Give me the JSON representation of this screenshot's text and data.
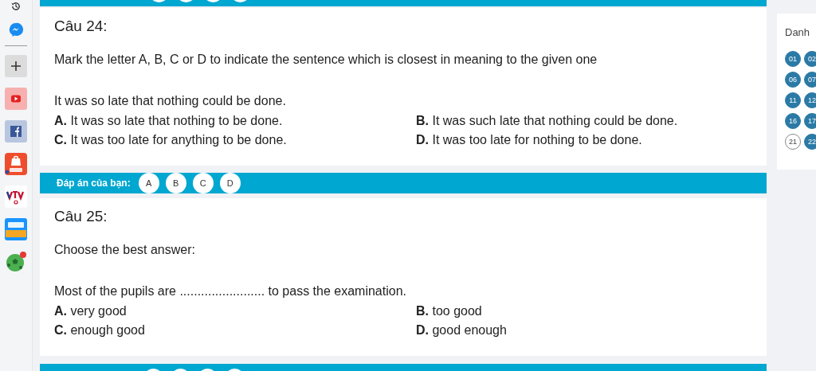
{
  "sidebar": {
    "items": [
      {
        "kind": "history"
      },
      {
        "kind": "messenger"
      },
      {
        "kind": "divider"
      },
      {
        "kind": "add"
      },
      {
        "kind": "youtube"
      },
      {
        "kind": "facebook"
      },
      {
        "kind": "shop"
      },
      {
        "kind": "tv"
      },
      {
        "kind": "sale"
      },
      {
        "kind": "ball"
      }
    ]
  },
  "questions": [
    {
      "title": "Câu 24:",
      "instruction": "Mark the letter A, B, C or D to indicate the sentence which is closest in meaning to the given one",
      "prompt": "It was so late that nothing could be done.",
      "options": [
        "**A.** It was so late that nothing to be done.",
        "**B.** It was such late that nothing could be done.",
        "**C.** It was too late for anything to be done.",
        "**D.** It was too late for nothing to be done."
      ],
      "answer_bar": {
        "label": "Đáp án của bạn:",
        "choices": [
          {
            "label": "A",
            "selected": false
          },
          {
            "label": "B",
            "selected": false
          },
          {
            "label": "C",
            "selected": false
          },
          {
            "label": "D",
            "selected": false
          }
        ]
      }
    },
    {
      "title": "Câu 25:",
      "instruction": "Choose the best answer:",
      "prompt": "Most of the pupils are ........................ to pass the examination.",
      "options": [
        "**A.** very good",
        "**B.** too good",
        "**C.** enough good",
        "**D.** good enough"
      ]
    }
  ],
  "question_list": {
    "title": "Danh",
    "items": [
      {
        "label": "01",
        "answered": true
      },
      {
        "label": "02",
        "answered": true
      },
      {
        "label": "06",
        "answered": true
      },
      {
        "label": "07",
        "answered": true
      },
      {
        "label": "11",
        "answered": true
      },
      {
        "label": "12",
        "answered": true
      },
      {
        "label": "16",
        "answered": true
      },
      {
        "label": "17",
        "answered": true
      },
      {
        "label": "21",
        "answered": false
      },
      {
        "label": "22",
        "answered": true
      }
    ]
  }
}
